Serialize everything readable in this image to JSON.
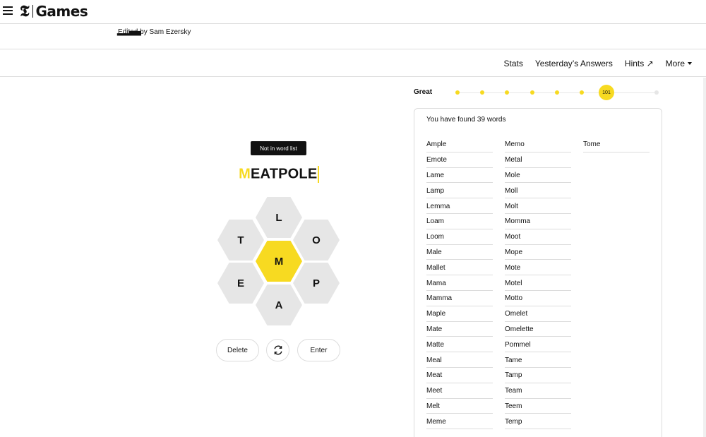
{
  "topbar": {
    "logo_mark": "𝕿",
    "logo_text": "Games"
  },
  "header": {
    "editor": "Edited by Sam Ezersky"
  },
  "nav": {
    "items": [
      "Stats",
      "Yesterday’s Answers",
      "Hints ↗",
      "More"
    ]
  },
  "toast": "Not in word list",
  "input": {
    "first_letter": "M",
    "rest": "EATPOLE"
  },
  "hive": {
    "center": "M",
    "outer": [
      "L",
      "T",
      "O",
      "E",
      "P",
      "A"
    ]
  },
  "buttons": {
    "delete": "Delete",
    "enter": "Enter",
    "shuffle_icon": "shuffle-icon"
  },
  "progress": {
    "rank": "Great",
    "score": "101",
    "filled_steps": 7,
    "total_steps": 9
  },
  "wordlist": {
    "found_text": "You have found 39 words",
    "columns": [
      [
        "Ample",
        "Emote",
        "Lame",
        "Lamp",
        "Lemma",
        "Loam",
        "Loom",
        "Male",
        "Mallet",
        "Mama",
        "Mamma",
        "Maple",
        "Mate",
        "Matte",
        "Meal",
        "Meat",
        "Meet",
        "Melt",
        "Meme"
      ],
      [
        "Memo",
        "Metal",
        "Mole",
        "Moll",
        "Molt",
        "Momma",
        "Moot",
        "Mope",
        "Mote",
        "Motel",
        "Motto",
        "Omelet",
        "Omelette",
        "Pommel",
        "Tame",
        "Tamp",
        "Team",
        "Teem",
        "Temp"
      ],
      [
        "Tome"
      ]
    ]
  },
  "colors": {
    "accent": "#f7da21",
    "cell": "#e6e6e6",
    "border": "#dcdcdc",
    "text": "#121212"
  }
}
